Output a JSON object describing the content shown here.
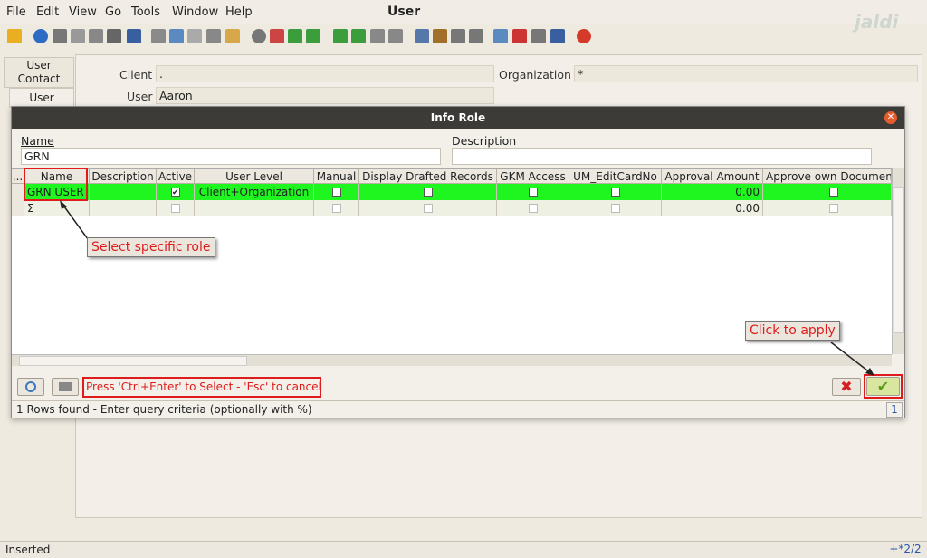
{
  "menu": [
    "File",
    "Edit",
    "View",
    "Go",
    "Tools",
    "Window",
    "Help"
  ],
  "window_title": "User",
  "brand": "jaldi",
  "side_tabs": [
    "User Contact",
    "User"
  ],
  "user_panel": {
    "client_label": "Client",
    "client_value": ".",
    "org_label": "Organization",
    "org_value": "*",
    "user_label": "User",
    "user_value": "Aaron"
  },
  "dialog": {
    "title": "Info Role",
    "name_label": "Name",
    "name_value": "GRN",
    "description_label": "Description",
    "description_value": "",
    "columns": [
      "...",
      "Name",
      "Description",
      "Active",
      "User Level",
      "Manual",
      "Display Drafted Records",
      "GKM Access",
      "UM_EditCardNo",
      "Approval Amount",
      "Approve own Documen"
    ],
    "rows": [
      {
        "name": "GRN USER",
        "description": "",
        "active": true,
        "user_level": "Client+Organization",
        "manual": false,
        "display_drafted": false,
        "gkm_access": false,
        "um_editcardno": false,
        "approval_amount": "0.00",
        "approve_own": false
      },
      {
        "name": "Σ",
        "description": "",
        "active": false,
        "user_level": "",
        "manual": false,
        "display_drafted": false,
        "gkm_access": false,
        "um_editcardno": false,
        "approval_amount": "0.00",
        "approve_own": false
      }
    ],
    "hint": "Press 'Ctrl+Enter' to Select - 'Esc' to cancel",
    "status": "1 Rows found - Enter query criteria (optionally with %)",
    "page": "1"
  },
  "annotations": {
    "select_role": "Select specific role",
    "click_apply": "Click to apply"
  },
  "statusbar": {
    "left": "Inserted",
    "right": "+*2/2"
  },
  "colors": {
    "selected_row": "#1ff51f",
    "annotation": "#e01b1b"
  }
}
